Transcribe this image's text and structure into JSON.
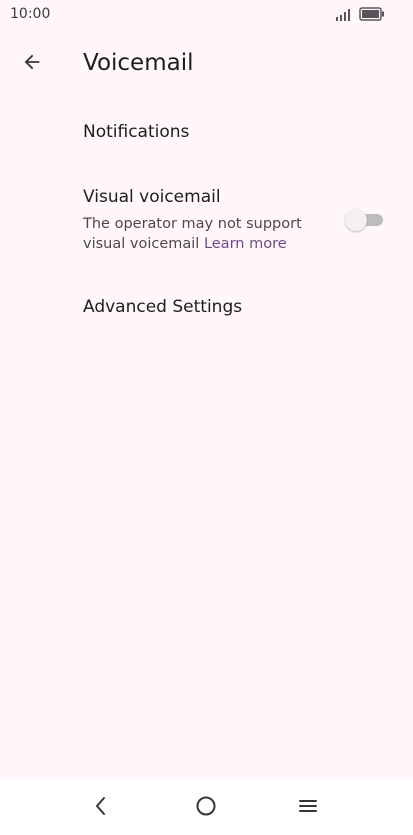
{
  "status_bar": {
    "time": "10:00",
    "signal_icon": "signal-icon",
    "battery_icon": "battery-icon"
  },
  "app_bar": {
    "back_icon": "arrow-back-icon",
    "title": "Voicemail"
  },
  "settings": {
    "notifications": {
      "title": "Notifications"
    },
    "visual_voicemail": {
      "title": "Visual voicemail",
      "summary": "The operator may not support visual voicemail",
      "learn_more": "Learn more",
      "enabled": false
    },
    "advanced": {
      "title": "Advanced Settings"
    }
  },
  "nav_bar": {
    "back_icon": "nav-back-icon",
    "home_icon": "nav-home-icon",
    "menu_icon": "nav-menu-icon"
  },
  "colors": {
    "background": "#fff7f8",
    "link": "#6b4a8a",
    "toggle_track": "#bdbdbd"
  }
}
